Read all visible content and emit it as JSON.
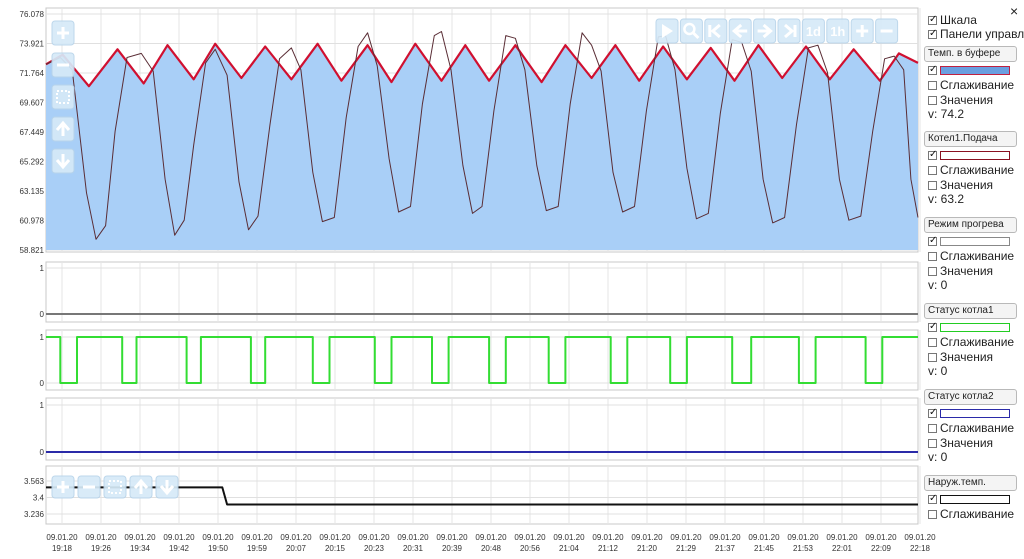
{
  "chart_data": [
    {
      "type": "area",
      "panel": "temps",
      "ylim": [
        58.821,
        76.078
      ],
      "yticks": [
        "76.078",
        "73.921",
        "71.764",
        "69.607",
        "67.449",
        "65.292",
        "63.135",
        "60.978",
        "58.821"
      ],
      "series": [
        {
          "name": "Темп. в буфере",
          "style": "area",
          "points": [
            [
              0,
              72.4
            ],
            [
              0.35,
              73.1
            ],
            [
              0.9,
              70.8
            ],
            [
              1.5,
              73.5
            ],
            [
              2.05,
              71.0
            ],
            [
              2.55,
              73.8
            ],
            [
              3.1,
              71.3
            ],
            [
              3.55,
              73.9
            ],
            [
              4.1,
              71.4
            ],
            [
              4.6,
              73.7
            ],
            [
              5.15,
              71.3
            ],
            [
              5.7,
              73.9
            ],
            [
              6.2,
              71.2
            ],
            [
              6.75,
              73.8
            ],
            [
              7.25,
              71.1
            ],
            [
              7.75,
              73.9
            ],
            [
              8.3,
              71.2
            ],
            [
              8.8,
              73.8
            ],
            [
              9.3,
              71.2
            ],
            [
              9.85,
              73.8
            ],
            [
              10.4,
              71.1
            ],
            [
              10.9,
              73.8
            ],
            [
              11.45,
              71.4
            ],
            [
              11.95,
              73.8
            ],
            [
              12.45,
              71.2
            ],
            [
              12.95,
              73.7
            ],
            [
              13.45,
              71.3
            ],
            [
              13.95,
              73.6
            ],
            [
              14.45,
              71.2
            ],
            [
              14.95,
              73.8
            ],
            [
              15.45,
              71.4
            ],
            [
              15.95,
              73.7
            ],
            [
              16.45,
              71.3
            ],
            [
              16.95,
              73.5
            ],
            [
              17.5,
              71.2
            ],
            [
              17.9,
              73.2
            ],
            [
              18.3,
              72.5
            ]
          ]
        },
        {
          "name": "Котел1.Подача",
          "style": "line",
          "points": [
            [
              0,
              72.4
            ],
            [
              0.3,
              72.9
            ],
            [
              0.55,
              72.0
            ],
            [
              0.85,
              63.0
            ],
            [
              1.05,
              59.6
            ],
            [
              1.25,
              60.6
            ],
            [
              1.45,
              67.5
            ],
            [
              1.7,
              72.9
            ],
            [
              2.0,
              73.2
            ],
            [
              2.25,
              71.9
            ],
            [
              2.5,
              64.0
            ],
            [
              2.7,
              59.9
            ],
            [
              2.9,
              61.0
            ],
            [
              3.1,
              66.5
            ],
            [
              3.35,
              72.5
            ],
            [
              3.55,
              73.5
            ],
            [
              3.8,
              71.6
            ],
            [
              4.05,
              63.8
            ],
            [
              4.25,
              60.3
            ],
            [
              4.45,
              61.3
            ],
            [
              4.7,
              68.0
            ],
            [
              4.9,
              72.8
            ],
            [
              5.15,
              73.6
            ],
            [
              5.35,
              72.0
            ],
            [
              5.6,
              64.5
            ],
            [
              5.8,
              60.9
            ],
            [
              6.05,
              61.2
            ],
            [
              6.3,
              68.5
            ],
            [
              6.55,
              73.7
            ],
            [
              6.75,
              74.7
            ],
            [
              6.95,
              72.3
            ],
            [
              7.2,
              65.5
            ],
            [
              7.4,
              61.6
            ],
            [
              7.65,
              62.0
            ],
            [
              7.9,
              69.5
            ],
            [
              8.15,
              74.5
            ],
            [
              8.3,
              74.8
            ],
            [
              8.5,
              72.0
            ],
            [
              8.75,
              65.0
            ],
            [
              8.95,
              61.5
            ],
            [
              9.15,
              62.0
            ],
            [
              9.4,
              69.0
            ],
            [
              9.65,
              74.5
            ],
            [
              9.85,
              74.3
            ],
            [
              10.05,
              72.0
            ],
            [
              10.3,
              65.0
            ],
            [
              10.5,
              61.7
            ],
            [
              10.75,
              62.0
            ],
            [
              11.0,
              69.5
            ],
            [
              11.25,
              74.7
            ],
            [
              11.45,
              73.8
            ],
            [
              11.65,
              71.9
            ],
            [
              11.9,
              64.5
            ],
            [
              12.1,
              61.6
            ],
            [
              12.35,
              62.0
            ],
            [
              12.6,
              69.0
            ],
            [
              12.85,
              74.4
            ],
            [
              13.0,
              74.5
            ],
            [
              13.2,
              72.0
            ],
            [
              13.45,
              64.8
            ],
            [
              13.65,
              61.1
            ],
            [
              13.9,
              61.5
            ],
            [
              14.15,
              68.8
            ],
            [
              14.4,
              74.2
            ],
            [
              14.6,
              74.0
            ],
            [
              14.8,
              71.9
            ],
            [
              15.05,
              64.0
            ],
            [
              15.25,
              60.8
            ],
            [
              15.5,
              61.2
            ],
            [
              15.75,
              68.0
            ],
            [
              16.0,
              73.6
            ],
            [
              16.2,
              73.8
            ],
            [
              16.4,
              71.8
            ],
            [
              16.65,
              64.0
            ],
            [
              16.85,
              61.0
            ],
            [
              17.1,
              61.3
            ],
            [
              17.35,
              67.5
            ],
            [
              17.6,
              72.8
            ],
            [
              17.8,
              73.0
            ],
            [
              18.0,
              72.0
            ],
            [
              18.15,
              64.0
            ],
            [
              18.3,
              61.2
            ]
          ]
        }
      ]
    },
    {
      "type": "line",
      "panel": "mode",
      "ylim": [
        0,
        1
      ],
      "yticks": [
        "1",
        "0"
      ],
      "series": [
        {
          "name": "Режим прогрева",
          "points": [
            [
              0,
              0
            ],
            [
              18.3,
              0
            ]
          ]
        }
      ]
    },
    {
      "type": "line",
      "panel": "status1",
      "ylim": [
        0,
        1
      ],
      "yticks": [
        "1",
        "0"
      ],
      "series": [
        {
          "name": "Статус котла1",
          "step": true,
          "points": [
            [
              0,
              1
            ],
            [
              0.3,
              1
            ],
            [
              0.3,
              0
            ],
            [
              0.65,
              0
            ],
            [
              0.65,
              1
            ],
            [
              1.6,
              1
            ],
            [
              1.6,
              0
            ],
            [
              1.9,
              0
            ],
            [
              1.9,
              1
            ],
            [
              2.95,
              1
            ],
            [
              2.95,
              0
            ],
            [
              3.25,
              0
            ],
            [
              3.25,
              1
            ],
            [
              4.3,
              1
            ],
            [
              4.3,
              0
            ],
            [
              4.6,
              0
            ],
            [
              4.6,
              1
            ],
            [
              5.6,
              1
            ],
            [
              5.6,
              0
            ],
            [
              5.95,
              0
            ],
            [
              5.95,
              1
            ],
            [
              6.9,
              1
            ],
            [
              6.9,
              0
            ],
            [
              7.25,
              0
            ],
            [
              7.25,
              1
            ],
            [
              8.1,
              1
            ],
            [
              8.1,
              0
            ],
            [
              8.45,
              0
            ],
            [
              8.45,
              1
            ],
            [
              9.3,
              1
            ],
            [
              9.3,
              0
            ],
            [
              9.65,
              0
            ],
            [
              9.65,
              1
            ],
            [
              10.55,
              1
            ],
            [
              10.55,
              0
            ],
            [
              10.9,
              0
            ],
            [
              10.9,
              1
            ],
            [
              11.85,
              1
            ],
            [
              11.85,
              0
            ],
            [
              12.2,
              0
            ],
            [
              12.2,
              1
            ],
            [
              13.1,
              1
            ],
            [
              13.1,
              0
            ],
            [
              13.45,
              0
            ],
            [
              13.45,
              1
            ],
            [
              14.4,
              1
            ],
            [
              14.4,
              0
            ],
            [
              14.8,
              0
            ],
            [
              14.8,
              1
            ],
            [
              15.8,
              1
            ],
            [
              15.8,
              0
            ],
            [
              16.15,
              0
            ],
            [
              16.15,
              1
            ],
            [
              17.2,
              1
            ],
            [
              17.2,
              0
            ],
            [
              17.55,
              0
            ],
            [
              17.55,
              1
            ],
            [
              18.3,
              1
            ]
          ]
        }
      ]
    },
    {
      "type": "line",
      "panel": "status2",
      "ylim": [
        0,
        1
      ],
      "yticks": [
        "1",
        "0"
      ],
      "series": [
        {
          "name": "Статус котла2",
          "points": [
            [
              0,
              0
            ],
            [
              18.3,
              0
            ]
          ]
        }
      ]
    },
    {
      "type": "line",
      "panel": "outdoor",
      "ylim": [
        3.236,
        3.563
      ],
      "yticks": [
        "3.563",
        "3.4",
        "3.236"
      ],
      "series": [
        {
          "name": "Наруж.темп.",
          "step": true,
          "points": [
            [
              0,
              3.5
            ],
            [
              3.7,
              3.5
            ],
            [
              3.8,
              3.33
            ],
            [
              18.3,
              3.33
            ]
          ]
        }
      ]
    }
  ],
  "x_axis": {
    "labels": [
      [
        "09.01.20",
        "19:18"
      ],
      [
        "09.01.20",
        "19:26"
      ],
      [
        "09.01.20",
        "19:34"
      ],
      [
        "09.01.20",
        "19:42"
      ],
      [
        "09.01.20",
        "19:50"
      ],
      [
        "09.01.20",
        "19:59"
      ],
      [
        "09.01.20",
        "20:07"
      ],
      [
        "09.01.20",
        "20:15"
      ],
      [
        "09.01.20",
        "20:23"
      ],
      [
        "09.01.20",
        "20:31"
      ],
      [
        "09.01.20",
        "20:39"
      ],
      [
        "09.01.20",
        "20:48"
      ],
      [
        "09.01.20",
        "20:56"
      ],
      [
        "09.01.20",
        "21:04"
      ],
      [
        "09.01.20",
        "21:12"
      ],
      [
        "09.01.20",
        "21:20"
      ],
      [
        "09.01.20",
        "21:29"
      ],
      [
        "09.01.20",
        "21:37"
      ],
      [
        "09.01.20",
        "21:45"
      ],
      [
        "09.01.20",
        "21:53"
      ],
      [
        "09.01.20",
        "22:01"
      ],
      [
        "09.01.20",
        "22:09"
      ],
      [
        "09.01.20",
        "22:18"
      ]
    ]
  },
  "colors": {
    "buffer_fill": "#a9cff7",
    "buffer_line": "#d01030",
    "feed_line": "#5a2d35",
    "mode_line": "#777777",
    "status1_line": "#33dd33",
    "status2_line": "#2a2aa8",
    "outdoor_line": "#111111",
    "button_fill": "#d6eaf8",
    "button_icon": "#ffffff"
  },
  "toolbar_icons": [
    "play-icon",
    "zoom-icon",
    "first-icon",
    "back-icon",
    "forward-icon",
    "last-icon",
    "1d",
    "1h",
    "plus-icon",
    "minus-icon"
  ],
  "side_panel": {
    "close": "×",
    "scale_label": "Шкала",
    "scale_checked": true,
    "panels_label": "Панели управл.",
    "panels_checked": true,
    "blocks": [
      {
        "title": "Темп. в буфере",
        "color": "#6a9fe0",
        "border": "#c02040",
        "smoothing": "Сглаживание",
        "values": "Значения",
        "value": "v: 74.2"
      },
      {
        "title": "Котел1.Подача",
        "color": "#ffffff",
        "border": "#8a1020",
        "smoothing": "Сглаживание",
        "values": "Значения",
        "value": "v: 63.2"
      },
      {
        "title": "Режим прогрева",
        "color": "#ffffff",
        "border": "#888888",
        "smoothing": "Сглаживание",
        "values": "Значения",
        "value": "v: 0"
      },
      {
        "title": "Статус котла1",
        "color": "#ffffff",
        "border": "#22cc22",
        "smoothing": "Сглаживание",
        "values": "Значения",
        "value": "v: 0"
      },
      {
        "title": "Статус котла2",
        "color": "#ffffff",
        "border": "#2a2aa8",
        "smoothing": "Сглаживание",
        "values": "Значения",
        "value": "v: 0"
      },
      {
        "title": "Наруж.темп.",
        "color": "#ffffff",
        "border": "#111111",
        "smoothing": "Сглаживание",
        "values": "",
        "value": ""
      }
    ]
  }
}
